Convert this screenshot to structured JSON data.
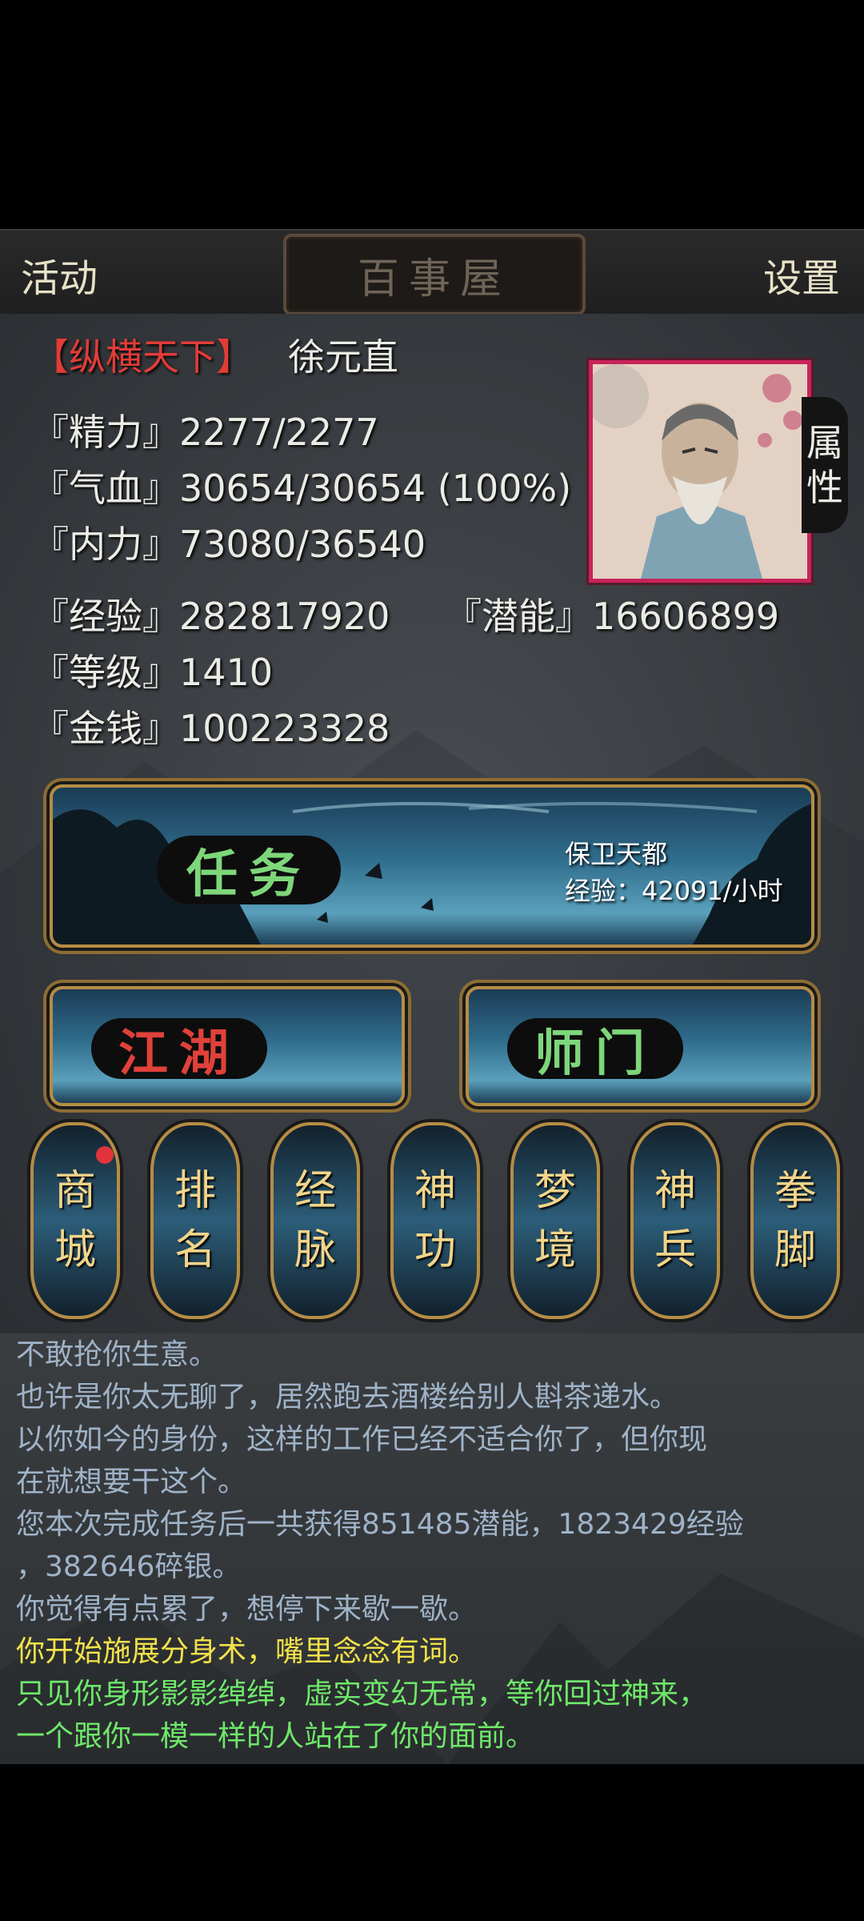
{
  "topbar": {
    "left": "活动",
    "title": "百事屋",
    "right": "设置"
  },
  "player": {
    "guild": "【纵横天下】",
    "name": "徐元直",
    "attr_tab": [
      "属",
      "性"
    ],
    "stats": {
      "energy": {
        "label": "『精力』",
        "value": "2277/2277"
      },
      "hp": {
        "label": "『气血』",
        "value": "30654/30654 (100%)"
      },
      "mp": {
        "label": "『内力』",
        "value": "73080/36540"
      },
      "exp": {
        "label": "『经验』",
        "value": "282817920"
      },
      "potential": {
        "label": "『潜能』",
        "value": "16606899"
      },
      "level": {
        "label": "『等级』",
        "value": "1410"
      },
      "money": {
        "label": "『金钱』",
        "value": "100223328"
      }
    }
  },
  "mission": {
    "label": "任务",
    "info_line1": "保卫天都",
    "info_line2": "经验：42091/小时"
  },
  "jianghu": {
    "label": "江湖"
  },
  "shimen": {
    "label": "师门"
  },
  "icons": [
    {
      "top": "商",
      "bottom": "城",
      "badge": true
    },
    {
      "top": "排",
      "bottom": "名",
      "badge": false
    },
    {
      "top": "经",
      "bottom": "脉",
      "badge": false
    },
    {
      "top": "神",
      "bottom": "功",
      "badge": false
    },
    {
      "top": "梦",
      "bottom": "境",
      "badge": false
    },
    {
      "top": "神",
      "bottom": "兵",
      "badge": false
    },
    {
      "top": "拳",
      "bottom": "脚",
      "badge": false
    }
  ],
  "log": [
    {
      "text": "不敢抢你生意。",
      "color": "blue"
    },
    {
      "text": "也许是你太无聊了，居然跑去酒楼给别人斟茶递水。",
      "color": "blue"
    },
    {
      "text": "以你如今的身份，这样的工作已经不适合你了，但你现",
      "color": "blue"
    },
    {
      "text": "在就想要干这个。",
      "color": "blue"
    },
    {
      "text": "您本次完成任务后一共获得851485潜能，1823429经验",
      "color": "blue"
    },
    {
      "text": "，382646碎银。",
      "color": "blue"
    },
    {
      "text": "你觉得有点累了，想停下来歇一歇。",
      "color": "blue"
    },
    {
      "text": "你开始施展分身术，嘴里念念有词。",
      "color": "yellow"
    },
    {
      "text": "只见你身形影影绰绰，虚实变幻无常，等你回过神来，",
      "color": "green"
    },
    {
      "text": "一个跟你一模一样的人站在了你的面前。",
      "color": "green"
    }
  ]
}
